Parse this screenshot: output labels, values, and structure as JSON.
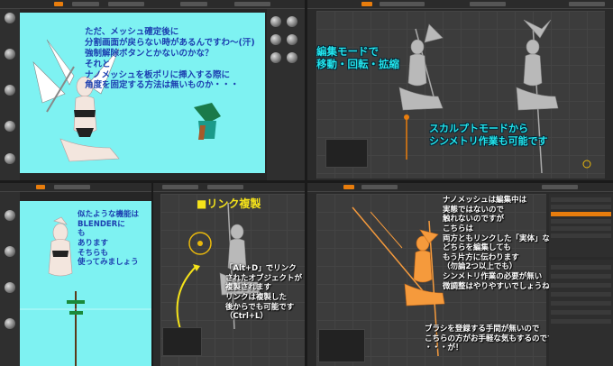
{
  "quadrants": {
    "top_left": {
      "app": "ZBrush",
      "caption_lines": [
        "ただ、メッシュ確定後に",
        "分割画面が戻らない時があるんですわ～(汗)",
        "強制解除ボタンとかないのかな？",
        "それと",
        "ナノメッシュを板ポリに挿入する際に",
        "角度を固定する方法は無いものか・・・"
      ]
    },
    "top_right": {
      "app": "Blender",
      "caption_top": [
        "編集モードで",
        "移動・回転・拡縮"
      ],
      "caption_bottom": [
        "スカルプトモードから",
        "シンメトリ作業も可能です"
      ]
    },
    "bottom_left": {
      "app": "ZBrush",
      "caption_lines": [
        "似たような機能は",
        "BLENDERに",
        "も",
        "あります",
        "そちらも",
        "使ってみましょう"
      ]
    },
    "bottom_center": {
      "app": "Blender",
      "title": "■リンク複製",
      "caption_lines": [
        "「Alt+D」でリンク",
        "されたオブジェクトが",
        "複製されます",
        "リンクは複製した",
        "後からでも可能です",
        "（Ctrl+L）"
      ]
    },
    "bottom_right": {
      "app": "Blender",
      "caption_lines": [
        "ナノメッシュは編集中は",
        "実態ではないので",
        "触れないのですが",
        "こちらは",
        "両方ともリンクした「実体」なので",
        "どちらを編集しても",
        "もう片方に伝わります",
        "（勿論2つ以上でも）",
        "シンメトリ作業の必要が無い",
        "微調整はやりやすいでしょうね"
      ],
      "caption_bottom": [
        "ブラシを登録する手間が無いので",
        "こちらの方がお手軽な気もするのです",
        "・・・が！"
      ]
    }
  },
  "colors": {
    "zbrush_bg": "#7ef2f2",
    "blender_bg": "#3c3c3c",
    "accent": "#e87d0d"
  }
}
